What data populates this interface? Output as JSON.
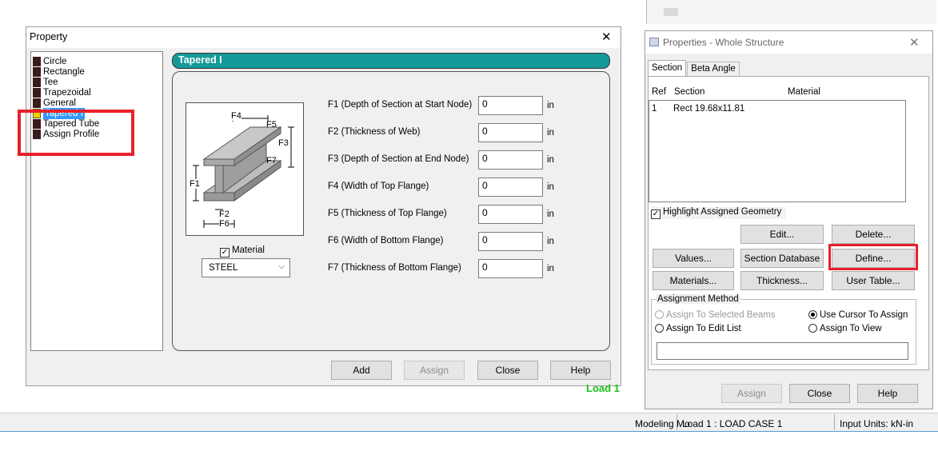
{
  "property_dialog": {
    "title": "Property",
    "close_glyph": "✕",
    "tree": [
      {
        "label": "Circle",
        "selected": false
      },
      {
        "label": "Rectangle",
        "selected": false
      },
      {
        "label": "Tee",
        "selected": false
      },
      {
        "label": "Trapezoidal",
        "selected": false
      },
      {
        "label": "General",
        "selected": false
      },
      {
        "label": "Tapered I",
        "selected": true
      },
      {
        "label": "Tapered Tube",
        "selected": false
      },
      {
        "label": "Assign Profile",
        "selected": false
      }
    ],
    "panel_title": "Tapered I",
    "fields": [
      {
        "label": "F1 (Depth of Section at Start Node)",
        "value": "0",
        "unit": "in"
      },
      {
        "label": "F2 (Thickness of Web)",
        "value": "0",
        "unit": "in"
      },
      {
        "label": "F3 (Depth of Section at End Node)",
        "value": "0",
        "unit": "in"
      },
      {
        "label": "F4 (Width of Top Flange)",
        "value": "0",
        "unit": "in"
      },
      {
        "label": "F5 (Thickness of Top Flange)",
        "value": "0",
        "unit": "in"
      },
      {
        "label": "F6 (Width of Bottom Flange)",
        "value": "0",
        "unit": "in"
      },
      {
        "label": "F7 (Thickness of Bottom Flange)",
        "value": "0",
        "unit": "in"
      }
    ],
    "diagram_labels": {
      "f1": "F1",
      "f2": "F2",
      "f3": "F3",
      "f4": "F4",
      "f5": "F5",
      "f6": "F6",
      "f7": "F7"
    },
    "material_label": "Material",
    "material_checked": true,
    "material_value": "STEEL",
    "buttons": {
      "add": "Add",
      "assign": "Assign",
      "close": "Close",
      "help": "Help"
    }
  },
  "background_text": {
    "load_label": "Load 1"
  },
  "properties_panel": {
    "title": "Properties - Whole Structure",
    "close_glyph": "✕",
    "tabs": [
      "Section",
      "Beta Angle"
    ],
    "columns": {
      "ref": "Ref",
      "section": "Section",
      "material": "Material"
    },
    "rows": [
      {
        "ref": "1",
        "section": "Rect 19.68x11.81",
        "material": ""
      }
    ],
    "highlight_label": "Highlight Assigned Geometry",
    "buttons": {
      "edit": "Edit...",
      "delete": "Delete...",
      "values": "Values...",
      "section_database": "Section Database",
      "define": "Define...",
      "materials": "Materials...",
      "thickness": "Thickness...",
      "user_table": "User Table..."
    },
    "assignment_method": {
      "legend": "Assignment Method",
      "assign_selected": "Assign To Selected Beams",
      "use_cursor": "Use Cursor To Assign",
      "assign_edit_list": "Assign To Edit List",
      "assign_view": "Assign To View"
    },
    "footer_buttons": {
      "assign": "Assign",
      "close": "Close",
      "help": "Help"
    }
  },
  "status_bar": {
    "mode": "Modeling Mo",
    "load_case": "Load 1 : LOAD CASE 1",
    "units": "Input Units:  kN-in"
  },
  "colors": {
    "highlight_red": "#e8202a",
    "teal_header": "#159a9a",
    "selection_blue": "#3399ff",
    "load_green": "#19c219"
  }
}
